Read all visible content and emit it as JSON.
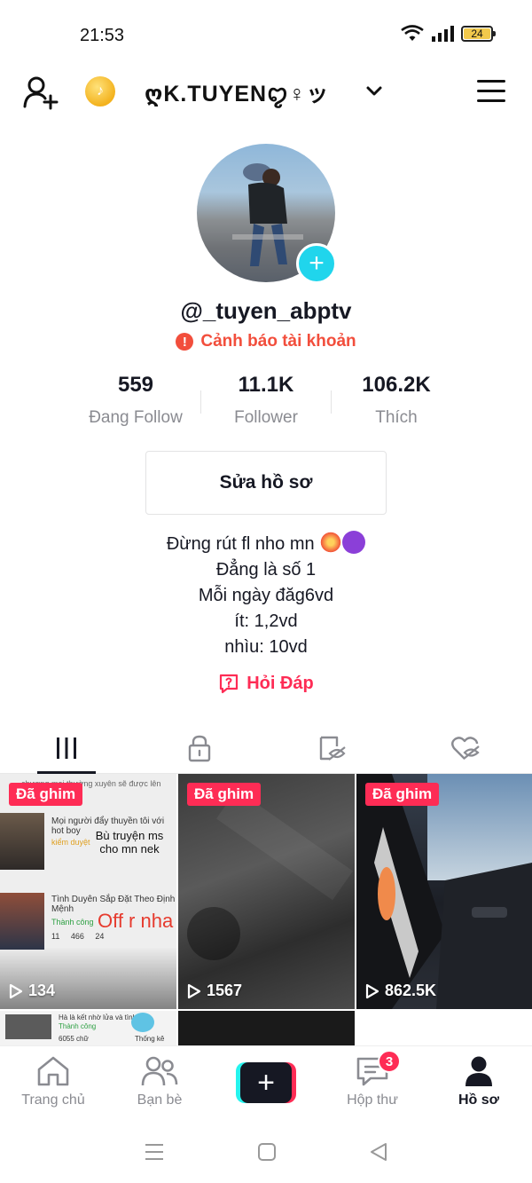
{
  "status_bar": {
    "time": "21:53",
    "battery": "24",
    "battery_level": 0.24
  },
  "header": {
    "display_name": "ღK.TUYENꨄ♀ッ"
  },
  "profile": {
    "handle": "@_tuyen_abptv",
    "warning": "Cảnh báo tài khoản",
    "stats": [
      {
        "value": "559",
        "label": "Đang Follow"
      },
      {
        "value": "11.1K",
        "label": "Follower"
      },
      {
        "value": "106.2K",
        "label": "Thích"
      }
    ],
    "edit_button": "Sửa hồ sơ",
    "bio": [
      "Đừng rút fl nho mn",
      "Đẳng là số 1",
      "Mỗi ngày đăg6vd",
      "ít: 1,2vd",
      "nhìu: 10vd"
    ],
    "qa": "Hỏi Đáp"
  },
  "videos": [
    {
      "pinned": "Đã ghim",
      "views": "134",
      "snippets": {
        "line_top": "chương mọi thường xuyên sẽ được lên",
        "item1_title": "Mọi người đẩy thuyền tôi với hot boy",
        "item1_sub": "kiểm duyệt",
        "overlay1": "Bù truyện ms cho mn nek",
        "item2_title": "Tình Duyên Sắp Đặt Theo Định Mệnh",
        "item2_sub": "Thành công",
        "item2_nums": "11     466     24",
        "overlay2": "Off r nha"
      }
    },
    {
      "pinned": "Đã ghim",
      "views": "1567"
    },
    {
      "pinned": "Đã ghim",
      "views": "862.5K"
    },
    {
      "snippets": {
        "line1": "Hà là kết nhờ lửa và tình nhé",
        "line2": "Thành công",
        "line3": "6055 chữ",
        "line4": "Thống kê"
      }
    }
  ],
  "bottom_nav": [
    {
      "label": "Trang chủ",
      "icon": "home-icon"
    },
    {
      "label": "Bạn bè",
      "icon": "friends-icon"
    },
    {
      "label": "",
      "icon": "create-icon"
    },
    {
      "label": "Hộp thư",
      "icon": "inbox-icon",
      "badge": "3"
    },
    {
      "label": "Hồ sơ",
      "icon": "profile-icon",
      "active": true
    }
  ],
  "colors": {
    "accent": "#fe2c55",
    "teal": "#20d5ec",
    "warning": "#f24e3c"
  }
}
